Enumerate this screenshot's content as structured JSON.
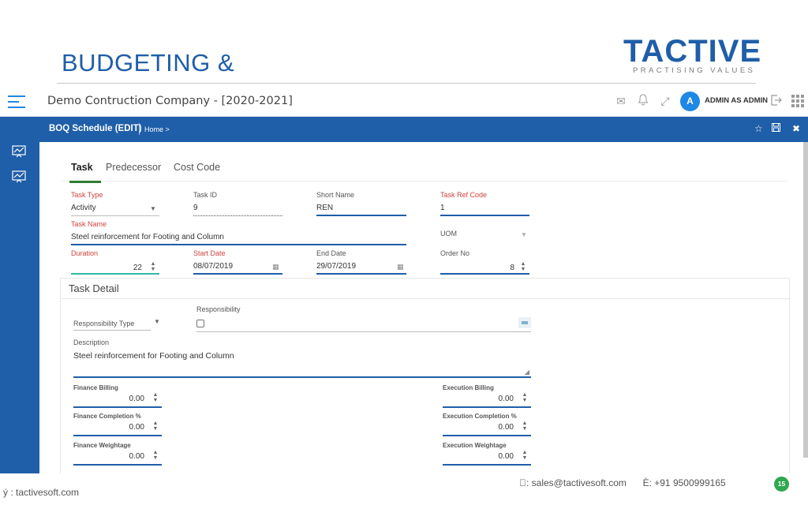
{
  "slide": {
    "title": "BUDGETING &",
    "logo": {
      "word": "TACTIVE",
      "tagline": "PRACTISING VALUES",
      "accent": "#3cb24a",
      "brand": "#1f5ea8"
    },
    "footer": {
      "website": "ý : tactivesoft.com",
      "email": "\u0000: sales@tactivesoft.com",
      "phone": "È: +91 9500999165",
      "page_number": "15"
    }
  },
  "app": {
    "company": "Demo Contruction Company - [2020-2021]",
    "user_initial": "A",
    "user_name": "ADMIN AS ADMIN",
    "screen_title": "BOQ Schedule (EDIT)",
    "breadcrumb": "Home >"
  },
  "tabs": [
    "Task",
    "Predecessor",
    "Cost Code"
  ],
  "form": {
    "task_type": {
      "label": "Task Type",
      "value": "Activity"
    },
    "task_id": {
      "label": "Task ID",
      "value": "9"
    },
    "short_name": {
      "label": "Short Name",
      "value": "REN"
    },
    "task_ref_code": {
      "label": "Task Ref Code",
      "value": "1"
    },
    "task_name": {
      "label": "Task Name",
      "value": "Steel reinforcement for Footing and Column"
    },
    "uom": {
      "label": "UOM",
      "value": ""
    },
    "duration": {
      "label": "Duration",
      "value": "22"
    },
    "start_date": {
      "label": "Start Date",
      "value": "08/07/2019"
    },
    "end_date": {
      "label": "End Date",
      "value": "29/07/2019"
    },
    "order_no": {
      "label": "Order No",
      "value": "8"
    }
  },
  "detail": {
    "title": "Task Detail",
    "responsibility_type": {
      "label": "Responsibility Type"
    },
    "responsibility": {
      "label": "Responsibility"
    },
    "description": {
      "label": "Description",
      "value": "Steel reinforcement for Footing and Column"
    },
    "finance_billing": {
      "label": "Finance Billing",
      "value": "0.00"
    },
    "finance_completion": {
      "label": "Finance Completion %",
      "value": "0.00"
    },
    "finance_weightage": {
      "label": "Finance Weightage",
      "value": "0.00"
    },
    "execution_billing": {
      "label": "Execution Billing",
      "value": "0.00"
    },
    "execution_completion": {
      "label": "Execution Completion %",
      "value": "0.00"
    },
    "execution_weightage": {
      "label": "Execution Weightage",
      "value": "0.00"
    }
  },
  "icons": {
    "dropdown": "▼",
    "spinner": "▲▼",
    "calendar": "▦",
    "mail": "✉",
    "bell": "🔔",
    "expand": "⤢",
    "logout": "⇥",
    "star": "☆",
    "save": "🖫",
    "close": "✖",
    "resize": "◢"
  }
}
